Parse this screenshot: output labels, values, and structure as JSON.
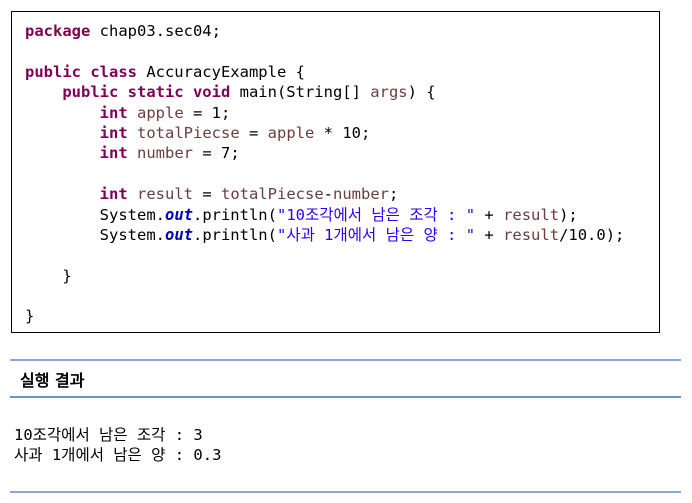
{
  "code": {
    "l1_kw": "package",
    "l1_rest": " chap03.sec04;",
    "l3_kw": "public class",
    "l3_rest": " AccuracyExample {",
    "l4_indent": "    ",
    "l4_kw": "public static void",
    "l4_mid": " main(String[] ",
    "l4_var": "args",
    "l4_end": ") {",
    "l5_indent": "        ",
    "l5_kw": "int",
    "l5_sp": " ",
    "l5_var": "apple",
    "l5_rest": " = 1;",
    "l6_indent": "        ",
    "l6_kw": "int",
    "l6_sp": " ",
    "l6_var": "totalPiecse",
    "l6_mid": " = ",
    "l6_var2": "apple",
    "l6_rest": " * 10;",
    "l7_indent": "        ",
    "l7_kw": "int",
    "l7_sp": " ",
    "l7_var": "number",
    "l7_rest": " = 7;",
    "l9_indent": "        ",
    "l9_kw": "int",
    "l9_sp": " ",
    "l9_var": "result",
    "l9_mid": " = ",
    "l9_var2": "totalPiecse",
    "l9_dash": "-",
    "l9_var3": "number",
    "l9_end": ";",
    "l10_indent": "        ",
    "l10_a": "System.",
    "l10_fld": "out",
    "l10_b": ".println(",
    "l10_str": "\"10조각에서 남은 조각 : \"",
    "l10_c": " + ",
    "l10_var": "result",
    "l10_end": ");",
    "l11_indent": "        ",
    "l11_a": "System.",
    "l11_fld": "out",
    "l11_b": ".println(",
    "l11_str": "\"사과 1개에서 남은 양 : \"",
    "l11_c": " + ",
    "l11_var": "result",
    "l11_end": "/10.0);",
    "l13_text": "    }",
    "l15_text": "}"
  },
  "result_section": {
    "title": "실행 결과",
    "output_lines": [
      "10조각에서 남은 조각 : 3",
      "사과 1개에서 남은 양 : 0.3"
    ]
  },
  "colors": {
    "keyword": "#7f0055",
    "variable": "#6a3e3e",
    "string": "#2a00ff",
    "field": "#0000c0",
    "rule": "#8aa8d8"
  }
}
